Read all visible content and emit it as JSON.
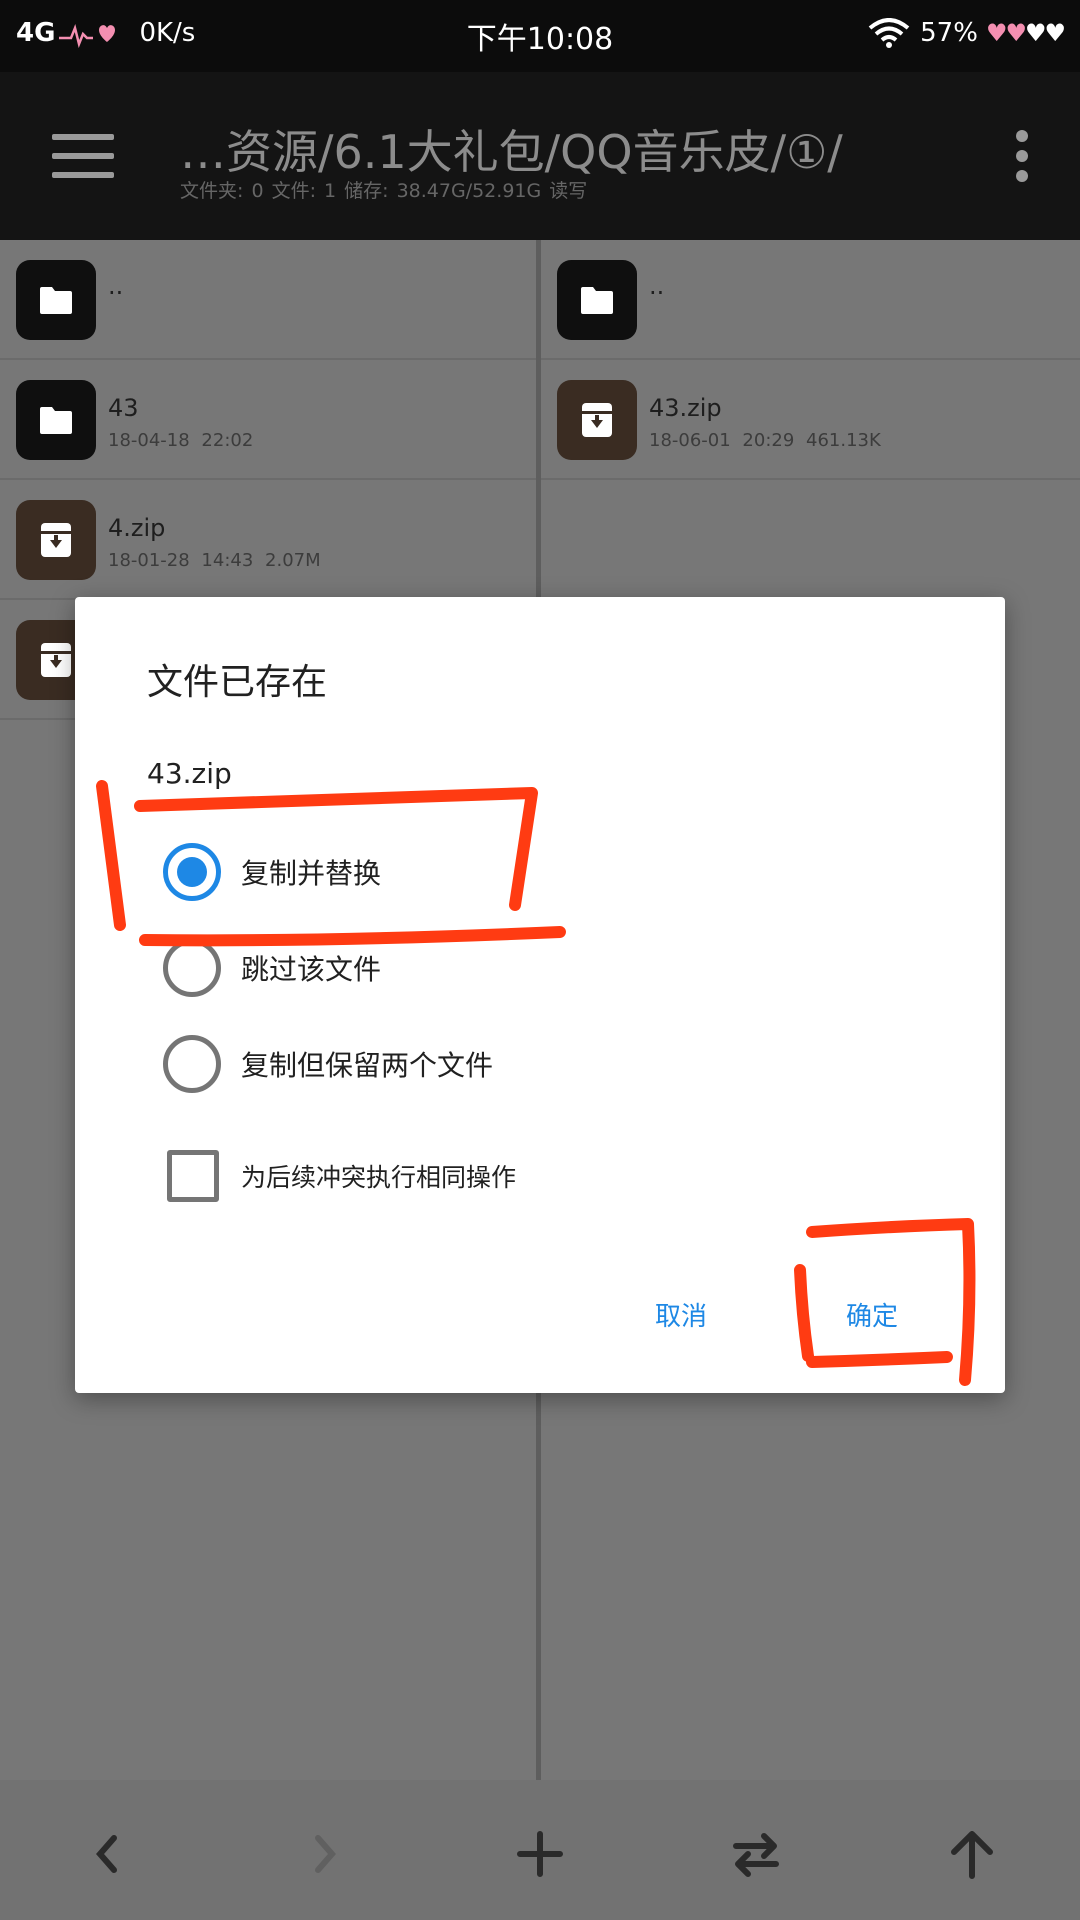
{
  "status_bar": {
    "network": "4G",
    "speed": "0K/s",
    "time": "下午10:08",
    "battery": "57%"
  },
  "toolbar": {
    "path": "…资源/6.1大礼包/QQ音乐皮/①/",
    "info": "文件夹: 0   文件: 1   储存: 38.47G/52.91G   读写"
  },
  "left_pane": {
    "items": [
      {
        "name": "..",
        "type": "folder",
        "meta": ""
      },
      {
        "name": "43",
        "type": "folder",
        "meta": "18-04-18 22:02"
      },
      {
        "name": "4.zip",
        "type": "zip",
        "meta": "18-01-28 14:43  2.07M"
      },
      {
        "name": "",
        "type": "zip",
        "meta": ""
      }
    ]
  },
  "right_pane": {
    "items": [
      {
        "name": "..",
        "type": "folder",
        "meta": ""
      },
      {
        "name": "43.zip",
        "type": "zip",
        "meta": "18-06-01 20:29  461.13K"
      }
    ]
  },
  "dialog": {
    "title": "文件已存在",
    "filename": "43.zip",
    "options": [
      {
        "label": "复制并替换",
        "selected": true
      },
      {
        "label": "跳过该文件",
        "selected": false
      },
      {
        "label": "复制但保留两个文件",
        "selected": false
      }
    ],
    "checkbox_label": "为后续冲突执行相同操作",
    "checkbox_checked": false,
    "cancel": "取消",
    "ok": "确定"
  },
  "bottom_bar": {
    "icons": [
      "back-arrow-icon",
      "forward-arrow-icon",
      "add-icon",
      "swap-icon",
      "up-arrow-icon"
    ]
  },
  "colors": {
    "accent": "#1e88e5",
    "annotation": "#ff3b12",
    "toolbar": "#141414"
  }
}
